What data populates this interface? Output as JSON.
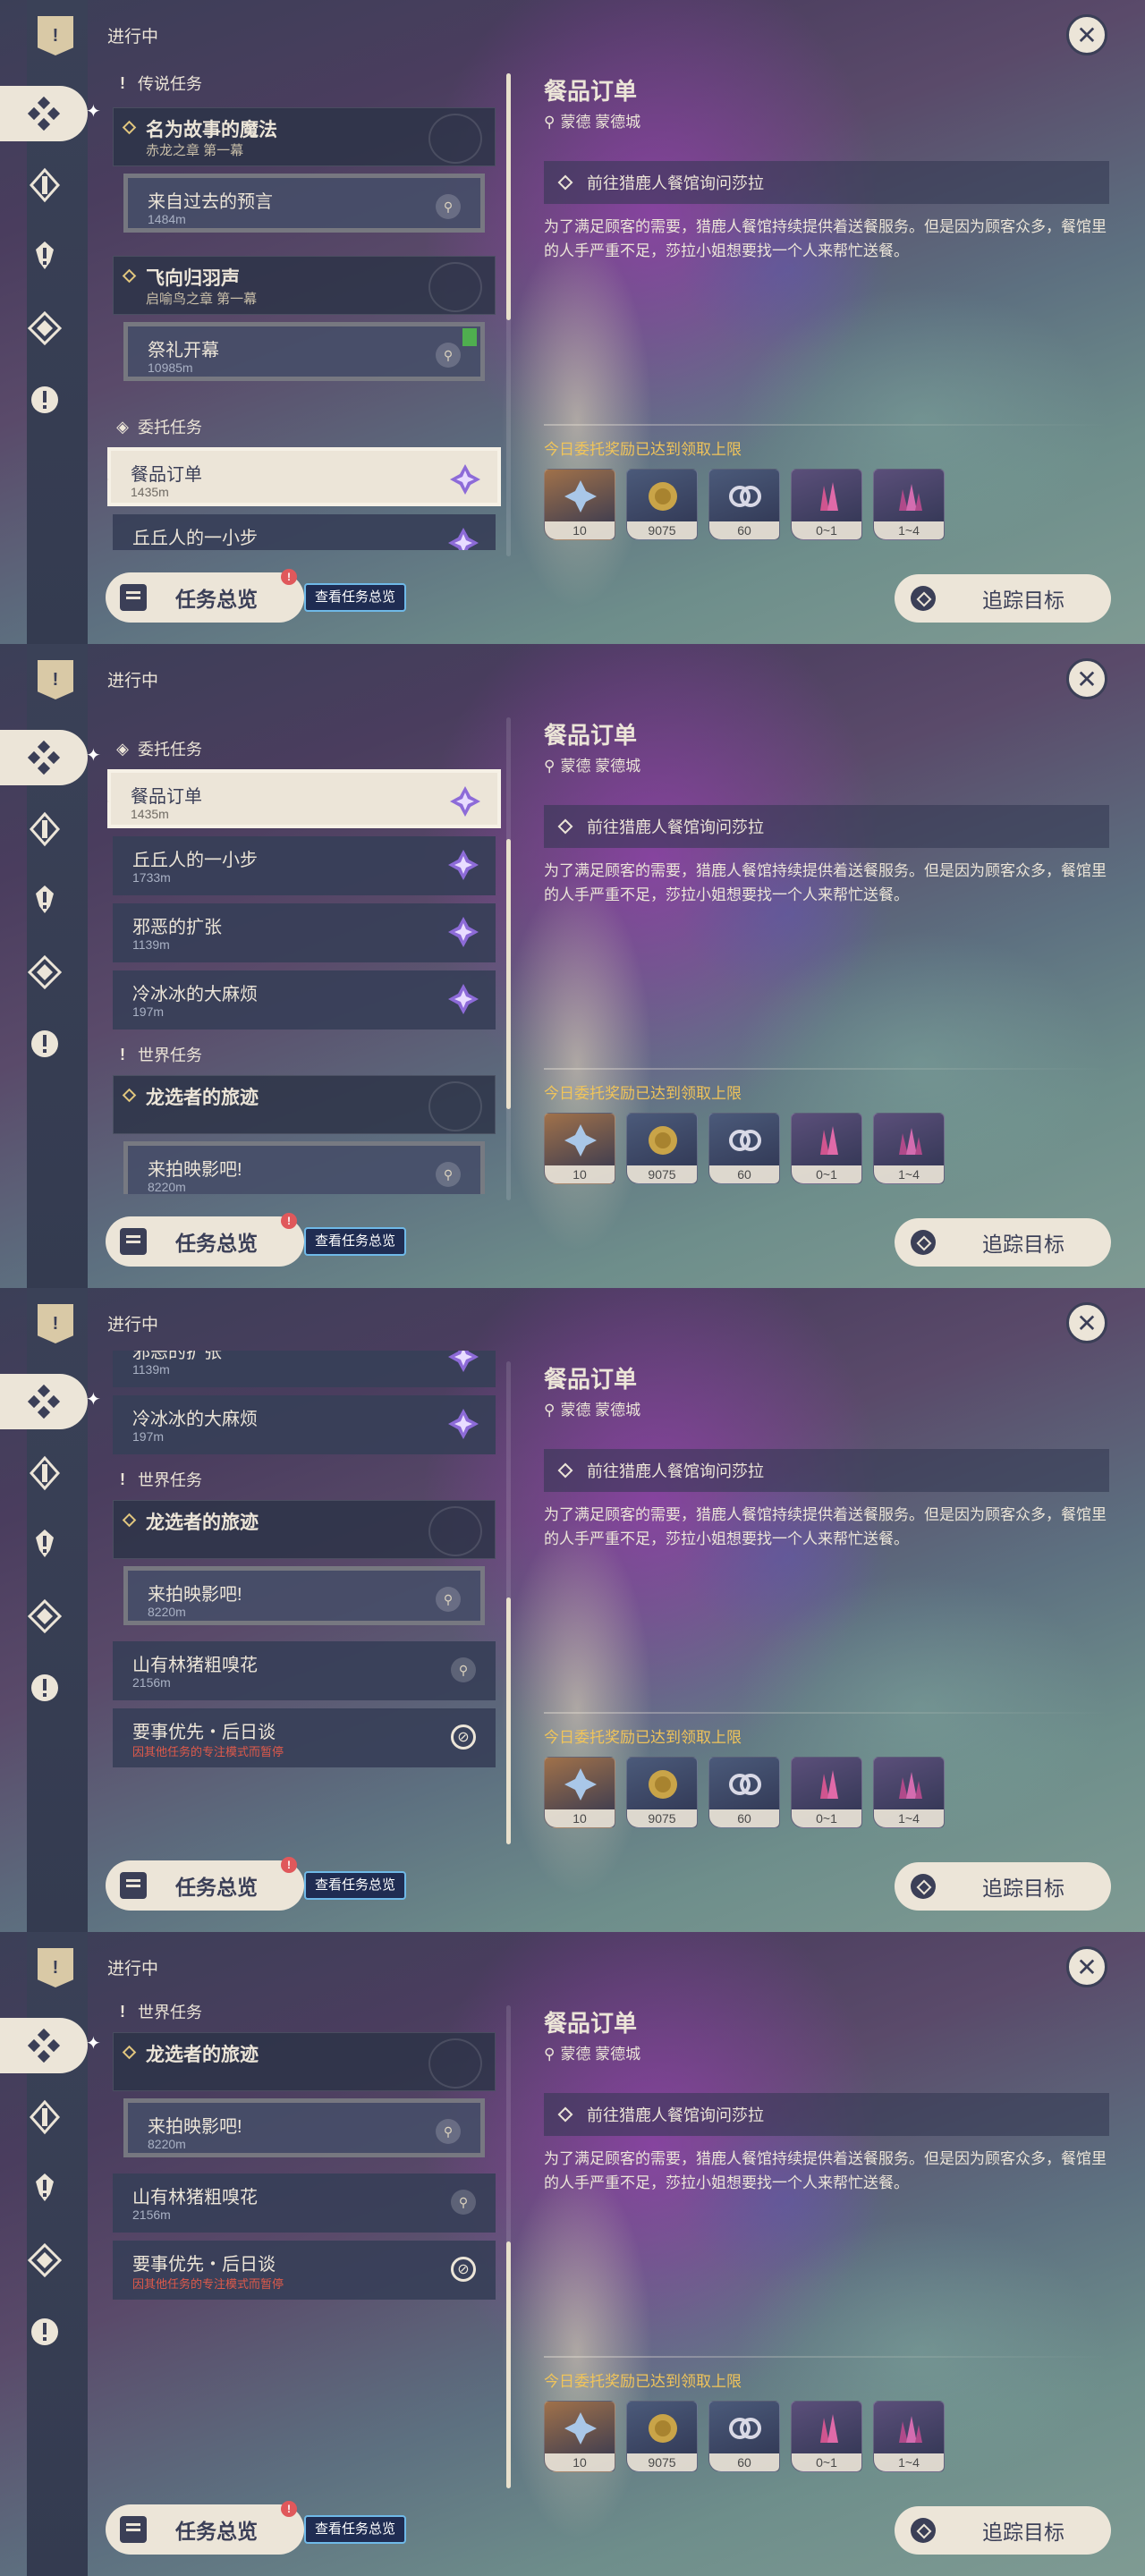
{
  "header": {
    "status": "进行中"
  },
  "groups": {
    "legend": "传说任务",
    "commission": "委托任务",
    "world": "世界任务"
  },
  "quests": {
    "legend1": {
      "title": "名为故事的魔法",
      "subtitle": "赤龙之章 第一幕"
    },
    "legend1_step": {
      "title": "来自过去的预言",
      "dist": "1484m"
    },
    "legend2": {
      "title": "飞向归羽声",
      "subtitle": "启喻鸟之章 第一幕"
    },
    "legend2_step": {
      "title": "祭礼开幕",
      "dist": "10985m"
    },
    "comm1": {
      "title": "餐品订单",
      "dist": "1435m"
    },
    "comm2": {
      "title": "丘丘人的一小步",
      "dist": "1733m"
    },
    "comm3": {
      "title": "邪恶的扩张",
      "dist": "1139m"
    },
    "comm4": {
      "title": "冷冰冰的大麻烦",
      "dist": "197m"
    },
    "world1": {
      "title": "龙选者的旅迹"
    },
    "world1_step": {
      "title": "来拍映影吧!",
      "dist": "8220m"
    },
    "world2": {
      "title": "山有林猪粗嗅花",
      "dist": "2156m"
    },
    "world3": {
      "title": "要事优先・后日谈",
      "warn": "因其他任务的专注模式而暂停"
    }
  },
  "detail": {
    "title": "餐品订单",
    "location": "蒙德 蒙德城",
    "step": "前往猎鹿人餐馆询问莎拉",
    "description": "为了满足顾客的需要，猎鹿人餐馆持续提供着送餐服务。但是因为顾客众多，餐馆里的人手严重不足，莎拉小姐想要找一个人来帮忙送餐。",
    "reward_header": "今日委托奖励已达到领取上限",
    "rewards": [
      {
        "icon": "adventure-exp-icon",
        "amount": "10",
        "color": "#a0714a"
      },
      {
        "icon": "mora-icon",
        "amount": "9075",
        "color": "#4b5a7a"
      },
      {
        "icon": "friendship-exp-icon",
        "amount": "60",
        "color": "#4b5a7a"
      },
      {
        "icon": "crystal-chunk-icon",
        "amount": "0~1",
        "color": "#5b4f7a"
      },
      {
        "icon": "crystal-cluster-icon",
        "amount": "1~4",
        "color": "#5b4f7a"
      }
    ]
  },
  "buttons": {
    "overview": "任务总览",
    "overview_badge": "!",
    "overview_hint": "查看任务总览",
    "track": "追踪目标"
  }
}
